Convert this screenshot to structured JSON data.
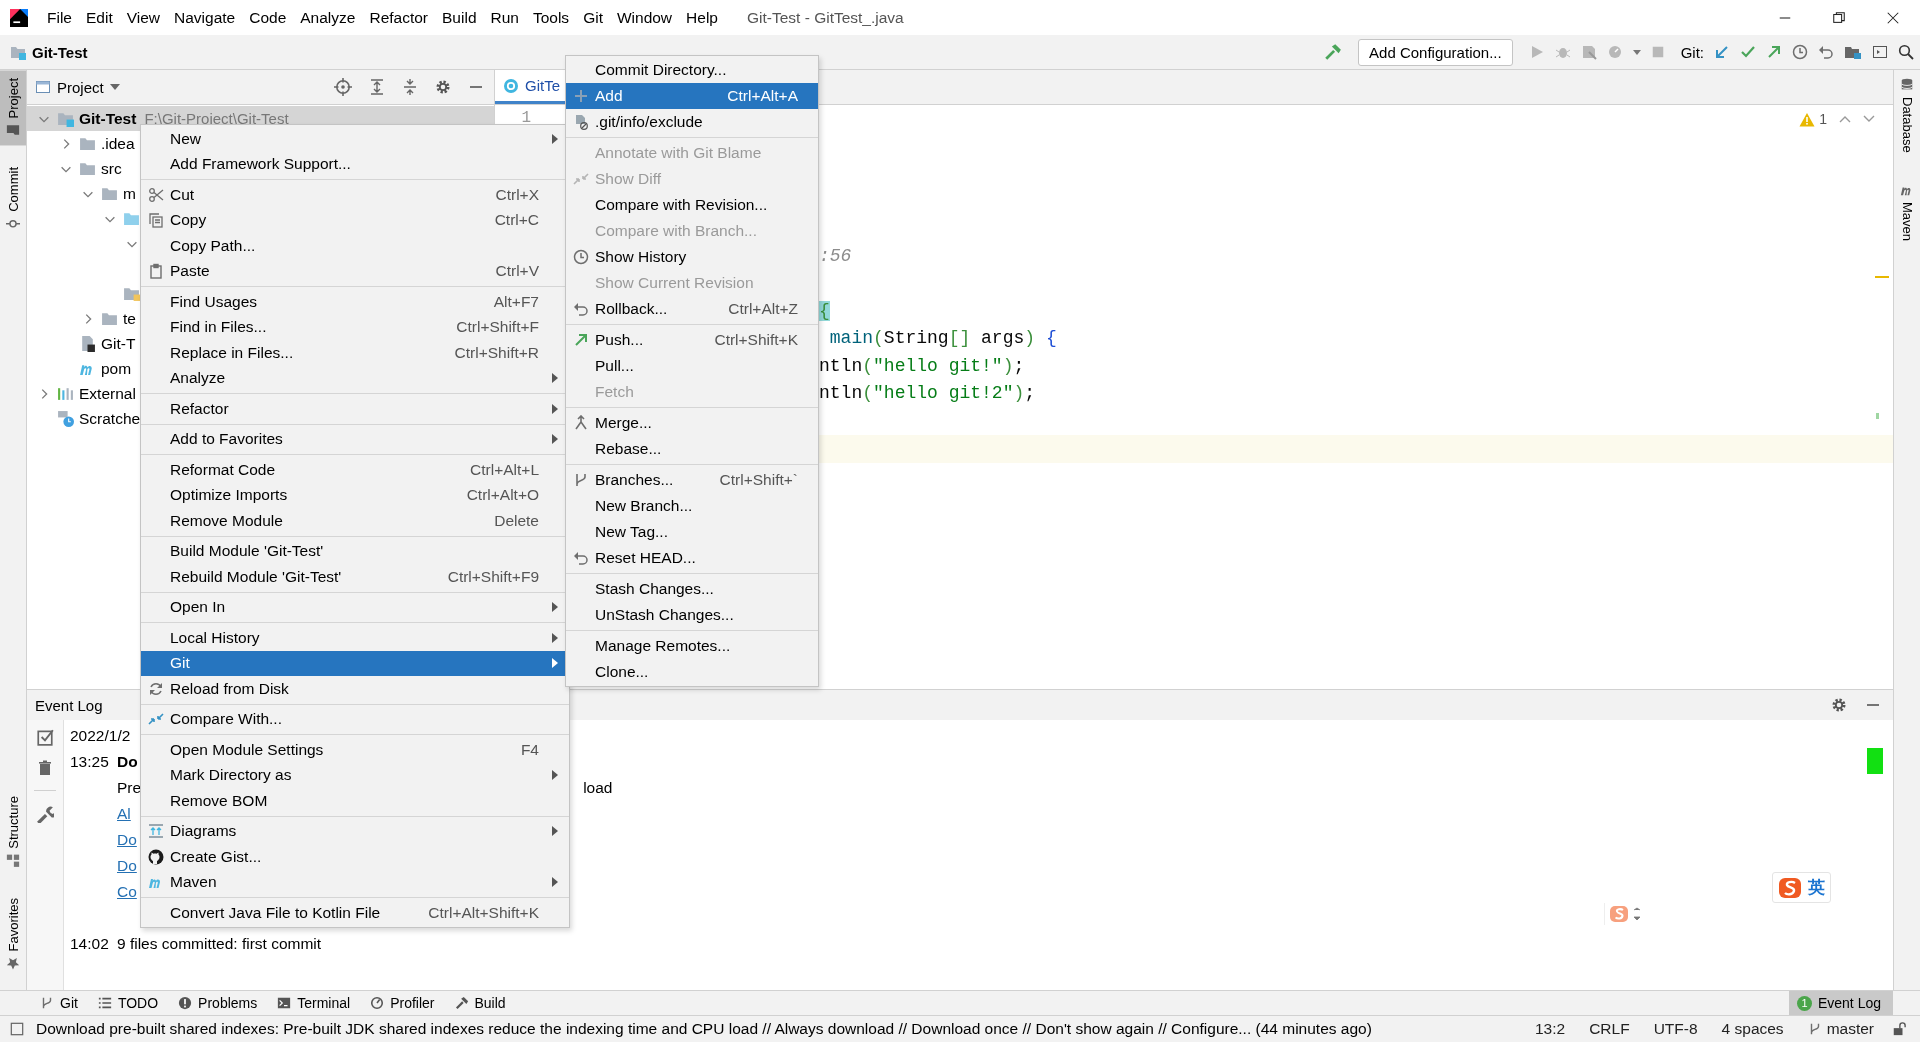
{
  "menu_bar": {
    "items": [
      "File",
      "Edit",
      "View",
      "Navigate",
      "Code",
      "Analyze",
      "Refactor",
      "Build",
      "Run",
      "Tools",
      "Git",
      "Window",
      "Help"
    ],
    "title": "Git-Test - GitTest_.java"
  },
  "nav_bar": {
    "breadcrumb": "Git-Test",
    "run_config": "Add Configuration...",
    "vcs_label": "Git:"
  },
  "left_tabs": [
    {
      "label": "Project",
      "selected": true
    },
    {
      "label": "Commit",
      "selected": false
    },
    {
      "label": "Structure",
      "selected": false
    },
    {
      "label": "Favorites",
      "selected": false
    }
  ],
  "right_tabs": [
    {
      "label": "Database"
    },
    {
      "label": "Maven"
    }
  ],
  "project": {
    "title": "Project",
    "tree": [
      {
        "label": "Git-Test",
        "path": "F:\\Git-Project\\Git-Test",
        "kind": "module",
        "selected": true,
        "expanded": true,
        "children": [
          {
            "label": ".idea",
            "kind": "folder",
            "selected": false,
            "expanded": false
          },
          {
            "label": "src",
            "kind": "folder",
            "selected": false,
            "expanded": true,
            "children": [
              {
                "label": "m",
                "kind": "folder",
                "selected": false,
                "expanded": true,
                "children": [
                  {
                    "kind": "source",
                    "selected": false,
                    "expanded": true,
                    "children": [
                      {
                        "selected": false,
                        "expanded": true,
                        "children": [
                          {
                            "selected": false
                          }
                        ]
                      }
                    ]
                  },
                  {
                    "kind": "resources",
                    "selected": false
                  }
                ]
              },
              {
                "label": "te",
                "kind": "folder",
                "selected": false,
                "expanded": false
              }
            ]
          },
          {
            "label": "Git-T",
            "kind": "file",
            "selected": false
          },
          {
            "label": "pom",
            "kind": "maven",
            "selected": false
          }
        ]
      },
      {
        "label": "External",
        "kind": "library",
        "selected": false,
        "expanded": false
      },
      {
        "label": "Scratche",
        "kind": "scratch",
        "selected": false
      }
    ]
  },
  "editor": {
    "tab": "GitTe",
    "gutter_numbers": [
      "1"
    ],
    "warnings": "1",
    "lines": [
      {
        "kind": "blank"
      },
      {
        "kind": "blank"
      },
      {
        "kind": "blank"
      },
      {
        "kind": "blank"
      },
      {
        "kind": "blank"
      },
      {
        "kind": "code",
        "tokens": [
          {
            "text": ":56",
            "kind": "comment"
          }
        ]
      },
      {
        "kind": "blank"
      },
      {
        "kind": "code",
        "tokens": [
          {
            "text": "{",
            "kind": "match"
          }
        ]
      },
      {
        "kind": "code",
        "tokens": [
          {
            "text": " main",
            "kind": "method"
          },
          {
            "text": "(",
            "kind": "paren"
          },
          {
            "text": "String",
            "kind": "plain"
          },
          {
            "text": "[]",
            "kind": "paren"
          },
          {
            "text": " args",
            "kind": "plain"
          },
          {
            "text": ")",
            "kind": "paren"
          },
          {
            "text": " {",
            "kind": "brace"
          }
        ]
      },
      {
        "kind": "code",
        "tokens": [
          {
            "text": "ntln",
            "kind": "plain"
          },
          {
            "text": "(",
            "kind": "paren"
          },
          {
            "text": "\"hello git!\"",
            "kind": "string"
          },
          {
            "text": ")",
            "kind": "paren"
          },
          {
            "text": ";",
            "kind": "plain"
          }
        ]
      },
      {
        "kind": "code",
        "tokens": [
          {
            "text": "ntln",
            "kind": "plain"
          },
          {
            "text": "(",
            "kind": "paren"
          },
          {
            "text": "\"hello git!2\"",
            "kind": "string"
          },
          {
            "text": ")",
            "kind": "paren"
          },
          {
            "text": ";",
            "kind": "plain"
          }
        ]
      },
      {
        "kind": "blank"
      },
      {
        "kind": "current"
      }
    ]
  },
  "event_log": {
    "title": "Event Log",
    "entries": [
      {
        "date": "2022/1/2",
        "time": "13:25",
        "title": "Do",
        "text": "Pre",
        "tail": "load",
        "links": [
          "Al",
          "Do",
          "Do",
          "Co"
        ]
      },
      {
        "time": "14:02",
        "text": "9 files committed: first commit"
      }
    ],
    "ime": {
      "label": "英"
    }
  },
  "context_menu": {
    "groups": [
      [
        {
          "label": "New",
          "submenu": true,
          "selected": false
        },
        {
          "label": "Add Framework Support...",
          "submenu": false,
          "selected": false
        }
      ],
      [
        {
          "label": "Cut",
          "shortcut": "Ctrl+X",
          "submenu": false,
          "selected": false
        },
        {
          "label": "Copy",
          "shortcut": "Ctrl+C",
          "submenu": false,
          "selected": false
        },
        {
          "label": "Copy Path...",
          "submenu": false,
          "selected": false
        },
        {
          "label": "Paste",
          "shortcut": "Ctrl+V",
          "submenu": false,
          "selected": false
        }
      ],
      [
        {
          "label": "Find Usages",
          "shortcut": "Alt+F7",
          "submenu": false,
          "selected": false
        },
        {
          "label": "Find in Files...",
          "shortcut": "Ctrl+Shift+F",
          "submenu": false,
          "selected": false
        },
        {
          "label": "Replace in Files...",
          "shortcut": "Ctrl+Shift+R",
          "submenu": false,
          "selected": false
        },
        {
          "label": "Analyze",
          "submenu": true,
          "selected": false
        }
      ],
      [
        {
          "label": "Refactor",
          "submenu": true,
          "selected": false
        }
      ],
      [
        {
          "label": "Add to Favorites",
          "submenu": true,
          "selected": false
        }
      ],
      [
        {
          "label": "Reformat Code",
          "shortcut": "Ctrl+Alt+L",
          "submenu": false,
          "selected": false
        },
        {
          "label": "Optimize Imports",
          "shortcut": "Ctrl+Alt+O",
          "submenu": false,
          "selected": false
        },
        {
          "label": "Remove Module",
          "shortcut": "Delete",
          "submenu": false,
          "selected": false
        }
      ],
      [
        {
          "label": "Build Module 'Git-Test'",
          "submenu": false,
          "selected": false
        },
        {
          "label": "Rebuild Module 'Git-Test'",
          "shortcut": "Ctrl+Shift+F9",
          "submenu": false,
          "selected": false
        }
      ],
      [
        {
          "label": "Open In",
          "submenu": true,
          "selected": false
        }
      ],
      [
        {
          "label": "Local History",
          "submenu": true,
          "selected": false
        },
        {
          "label": "Git",
          "submenu": true,
          "selected": true
        },
        {
          "label": "Reload from Disk",
          "submenu": false,
          "selected": false
        }
      ],
      [
        {
          "label": "Compare With...",
          "submenu": false,
          "selected": false
        }
      ],
      [
        {
          "label": "Open Module Settings",
          "shortcut": "F4",
          "submenu": false,
          "selected": false
        },
        {
          "label": "Mark Directory as",
          "submenu": true,
          "selected": false
        },
        {
          "label": "Remove BOM",
          "submenu": false,
          "selected": false
        }
      ],
      [
        {
          "label": "Diagrams",
          "submenu": true,
          "selected": false
        },
        {
          "label": "Create Gist...",
          "submenu": false,
          "selected": false
        },
        {
          "label": "Maven",
          "submenu": true,
          "selected": false
        }
      ],
      [
        {
          "label": "Convert Java File to Kotlin File",
          "shortcut": "Ctrl+Alt+Shift+K",
          "submenu": false,
          "selected": false
        }
      ]
    ]
  },
  "git_menu": {
    "groups": [
      [
        {
          "label": "Commit Directory...",
          "selected": false,
          "disabled": false
        },
        {
          "label": "Add",
          "shortcut": "Ctrl+Alt+A",
          "selected": true,
          "disabled": false
        },
        {
          "label": ".git/info/exclude",
          "selected": false,
          "disabled": false
        }
      ],
      [
        {
          "label": "Annotate with Git Blame",
          "selected": false,
          "disabled": true
        },
        {
          "label": "Show Diff",
          "selected": false,
          "disabled": true
        },
        {
          "label": "Compare with Revision...",
          "selected": false,
          "disabled": false
        },
        {
          "label": "Compare with Branch...",
          "selected": false,
          "disabled": true
        },
        {
          "label": "Show History",
          "selected": false,
          "disabled": false
        },
        {
          "label": "Show Current Revision",
          "selected": false,
          "disabled": true
        },
        {
          "label": "Rollback...",
          "shortcut": "Ctrl+Alt+Z",
          "selected": false,
          "disabled": false
        }
      ],
      [
        {
          "label": "Push...",
          "shortcut": "Ctrl+Shift+K",
          "selected": false,
          "disabled": false
        },
        {
          "label": "Pull...",
          "selected": false,
          "disabled": false
        },
        {
          "label": "Fetch",
          "selected": false,
          "disabled": true
        }
      ],
      [
        {
          "label": "Merge...",
          "selected": false,
          "disabled": false
        },
        {
          "label": "Rebase...",
          "selected": false,
          "disabled": false
        }
      ],
      [
        {
          "label": "Branches...",
          "shortcut": "Ctrl+Shift+`",
          "selected": false,
          "disabled": false
        },
        {
          "label": "New Branch...",
          "selected": false,
          "disabled": false
        },
        {
          "label": "New Tag...",
          "selected": false,
          "disabled": false
        },
        {
          "label": "Reset HEAD...",
          "selected": false,
          "disabled": false
        }
      ],
      [
        {
          "label": "Stash Changes...",
          "selected": false,
          "disabled": false
        },
        {
          "label": "UnStash Changes...",
          "selected": false,
          "disabled": false
        }
      ],
      [
        {
          "label": "Manage Remotes...",
          "selected": false,
          "disabled": false
        },
        {
          "label": "Clone...",
          "selected": false,
          "disabled": false
        }
      ]
    ]
  },
  "tool_tabs": [
    {
      "label": "Git",
      "selected": false
    },
    {
      "label": "TODO",
      "selected": false
    },
    {
      "label": "Problems",
      "selected": false
    },
    {
      "label": "Terminal",
      "selected": false
    },
    {
      "label": "Profiler",
      "selected": false
    },
    {
      "label": "Build",
      "selected": false
    }
  ],
  "event_log_tab": {
    "label": "Event Log",
    "badge": "1",
    "selected": true
  },
  "status_bar": {
    "message": "Download pre-built shared indexes: Pre-built JDK shared indexes reduce the indexing time and CPU load // Always download // Download once // Don't show again // Configure... (44 minutes ago)",
    "position": "13:2",
    "line_sep": "CRLF",
    "encoding": "UTF-8",
    "indent": "4 spaces",
    "branch": "master"
  }
}
